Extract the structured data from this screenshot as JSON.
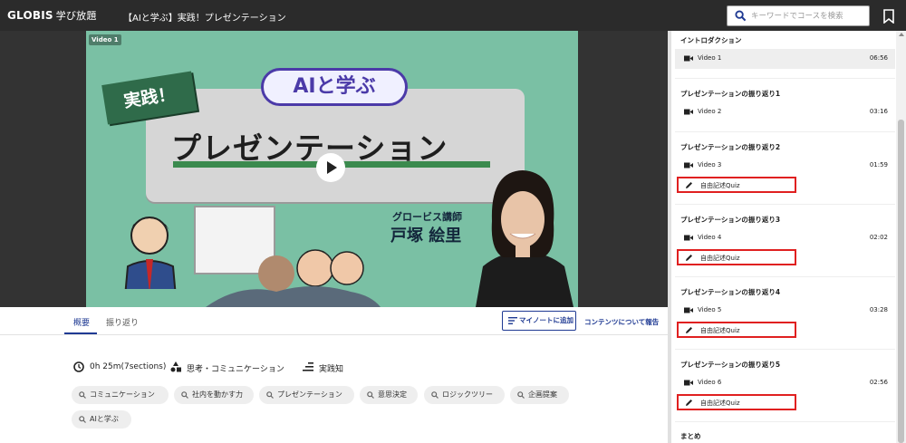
{
  "header": {
    "logo_main": "GLOBIS",
    "logo_sub": "学び放題",
    "course_title": "【AIと学ぶ】実践！プレゼンテーション",
    "search_placeholder": "キーワードでコースを検索"
  },
  "video": {
    "label": "Video 1",
    "thumbnail": {
      "pill": "AIと学ぶ",
      "badge": "実践！",
      "headline": "プレゼンテーション",
      "instructor_role": "グロービス講師",
      "instructor_name": "戸塚 絵里"
    }
  },
  "tabs": [
    {
      "label": "概要",
      "active": true
    },
    {
      "label": "振り返り",
      "active": false
    }
  ],
  "actions": {
    "note_button": "マイノートに追加",
    "report_link": "コンテンツについて報告"
  },
  "meta": {
    "duration": "0h 25m(7sections)",
    "category": "思考・コミュニケーション",
    "level": "実践知"
  },
  "tags": [
    "コミュニケーション",
    "社内を動かす力",
    "プレゼンテーション",
    "意思決定",
    "ロジックツリー",
    "企画提案",
    "AIと学ぶ"
  ],
  "sidebar": {
    "sections": [
      {
        "title": "イントロダクション",
        "video": {
          "label": "Video 1",
          "time": "06:56"
        }
      },
      {
        "title": "プレゼンテーションの振り返り1",
        "video": {
          "label": "Video 2",
          "time": "03:16"
        }
      },
      {
        "title": "プレゼンテーションの振り返り2",
        "video": {
          "label": "Video 3",
          "time": "01:59"
        },
        "quiz": "自由記述Quiz"
      },
      {
        "title": "プレゼンテーションの振り返り3",
        "video": {
          "label": "Video 4",
          "time": "02:02"
        },
        "quiz": "自由記述Quiz"
      },
      {
        "title": "プレゼンテーションの振り返り4",
        "video": {
          "label": "Video 5",
          "time": "03:28"
        },
        "quiz": "自由記述Quiz"
      },
      {
        "title": "プレゼンテーションの振り返り5",
        "video": {
          "label": "Video 6",
          "time": "02:56"
        },
        "quiz": "自由記述Quiz"
      },
      {
        "title": "まとめ"
      }
    ]
  },
  "colors": {
    "accent": "#1f3a93",
    "quiz_highlight": "#e02020",
    "header_bg": "#2b2b2b"
  }
}
